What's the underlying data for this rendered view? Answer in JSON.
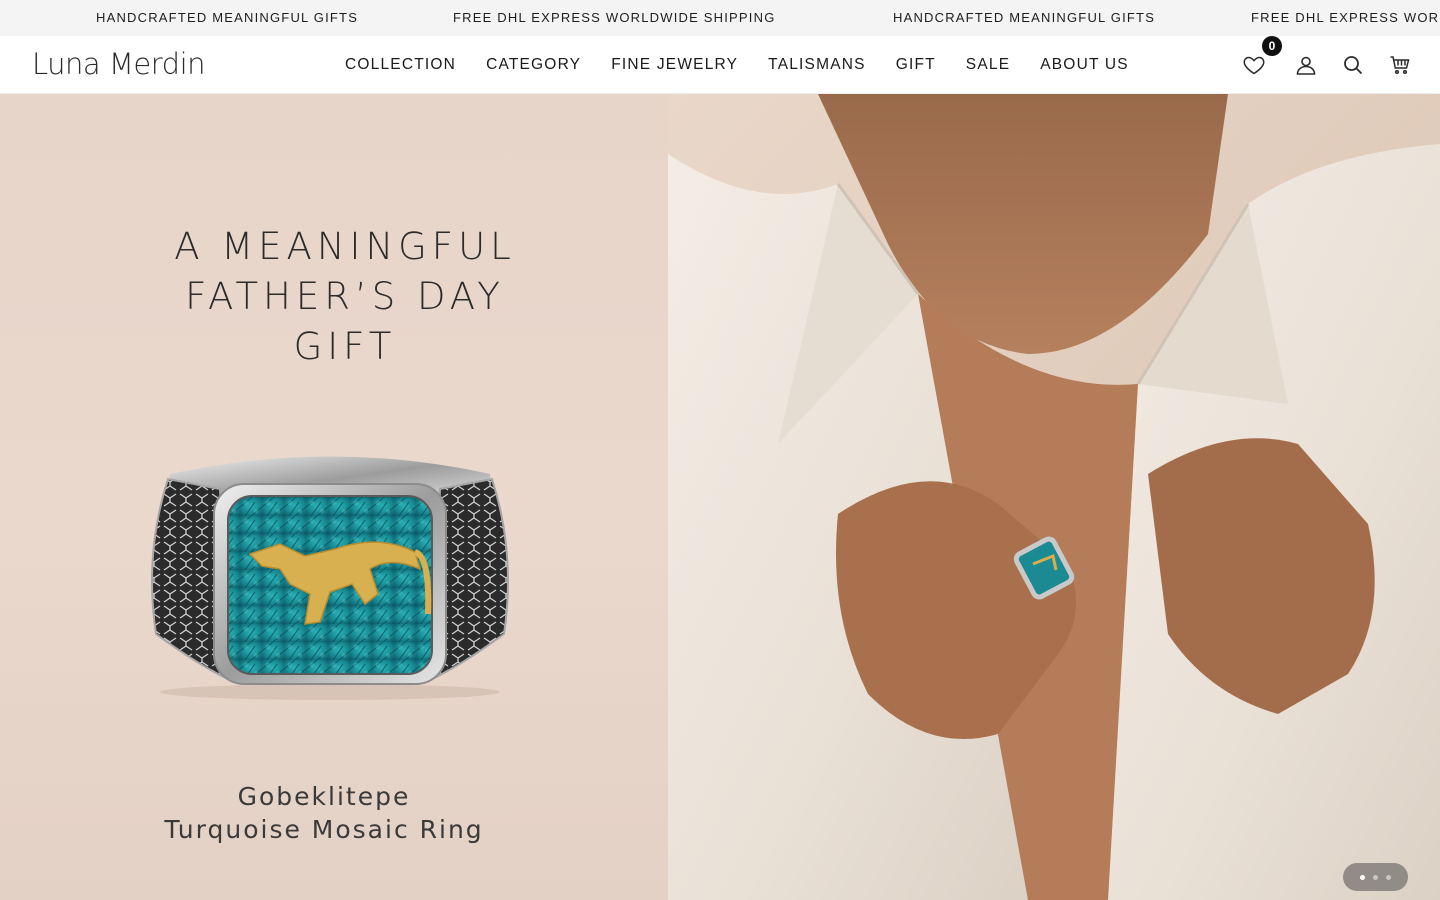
{
  "announcement": {
    "messages": [
      "HANDCRAFTED MEANINGFUL GIFTS",
      "FREE DHL EXPRESS WORLDWIDE SHIPPING",
      "HANDCRAFTED MEANINGFUL GIFTS",
      "FREE DHL EXPRESS WORLDWIDE SHIPPING"
    ]
  },
  "header": {
    "logo": "Luna Merdin",
    "nav": [
      {
        "label": "COLLECTION"
      },
      {
        "label": "CATEGORY"
      },
      {
        "label": "FINE JEWELRY"
      },
      {
        "label": "TALISMANS"
      },
      {
        "label": "GIFT"
      },
      {
        "label": "SALE"
      },
      {
        "label": "ABOUT US"
      }
    ],
    "icons": {
      "wishlist": "heart-icon",
      "account": "user-icon",
      "search": "search-icon",
      "cart": "cart-icon"
    },
    "wishlist_count": "0"
  },
  "hero": {
    "headline_lines": [
      "A MEANINGFUL",
      "FATHER’S DAY",
      "GIFT"
    ],
    "product_lines": [
      "Gobeklitepe",
      "Turquoise Mosaic Ring"
    ],
    "slides": {
      "total": 3,
      "active": 1
    }
  },
  "colors": {
    "hero_bg": "#e8d6cb",
    "announcement_bg": "#f4f4f4",
    "turquoise": "#1f8f96",
    "gold": "#d8ad4a",
    "badge": "#111111"
  }
}
